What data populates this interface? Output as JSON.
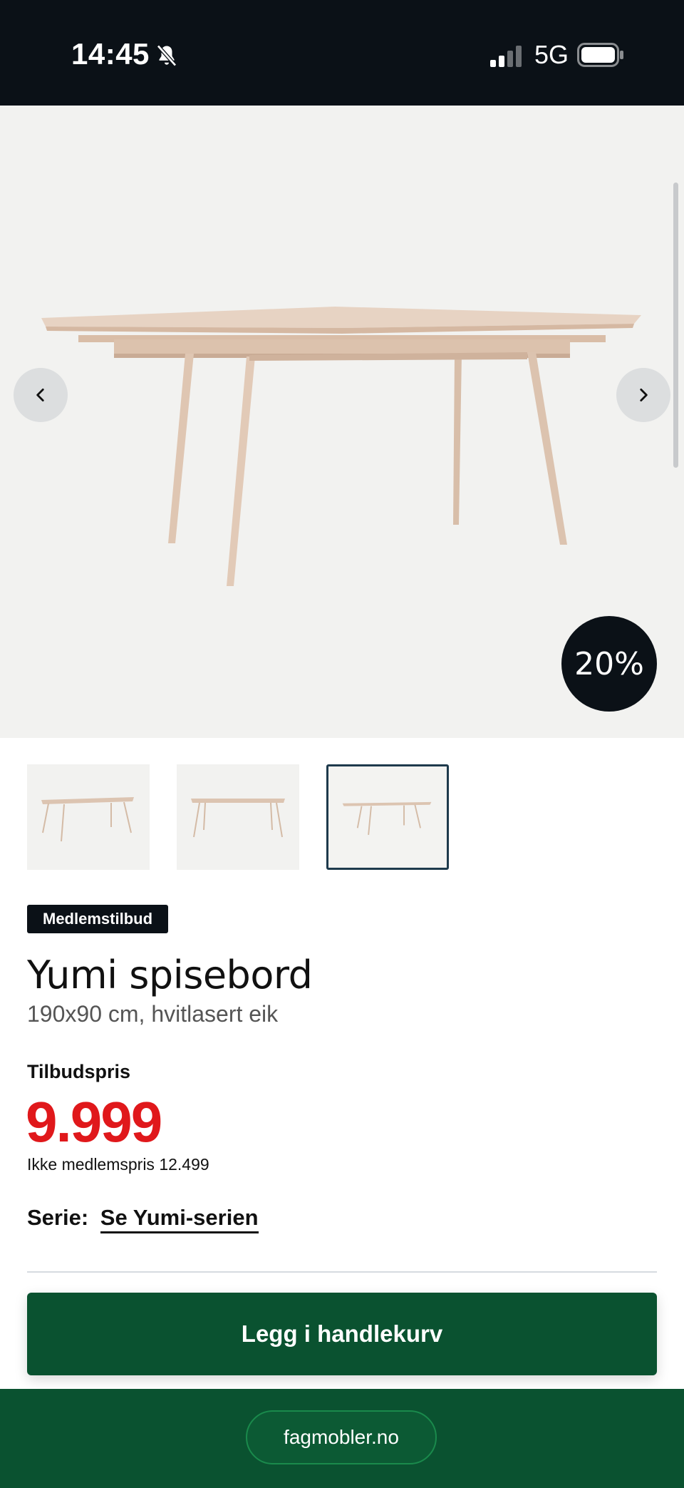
{
  "status_bar": {
    "time": "14:45",
    "network": "5G",
    "icons": [
      "bell-slash-icon",
      "signal-icon",
      "battery-icon"
    ]
  },
  "gallery": {
    "discount": "20%",
    "thumbnail_count": 3,
    "active_thumbnail": 3,
    "icons": [
      "chevron-left-icon",
      "chevron-right-icon"
    ]
  },
  "product": {
    "badge": "Medlemstilbud",
    "title": "Yumi spisebord",
    "subtitle": "190x90 cm, hvitlasert eik",
    "price_label": "Tilbudspris",
    "price": "9.999",
    "regular_price": "Ikke medlemspris 12.499",
    "series_label": "Serie:",
    "series_link": "Se Yumi-serien"
  },
  "actions": {
    "add_to_cart": "Legg i handlekurv"
  },
  "browser": {
    "url": "fagmobler.no"
  },
  "colors": {
    "status_bar": "#0b1117",
    "price": "#e0181b",
    "primary_green": "#0a5230",
    "gallery_bg": "#f2f2f0"
  }
}
